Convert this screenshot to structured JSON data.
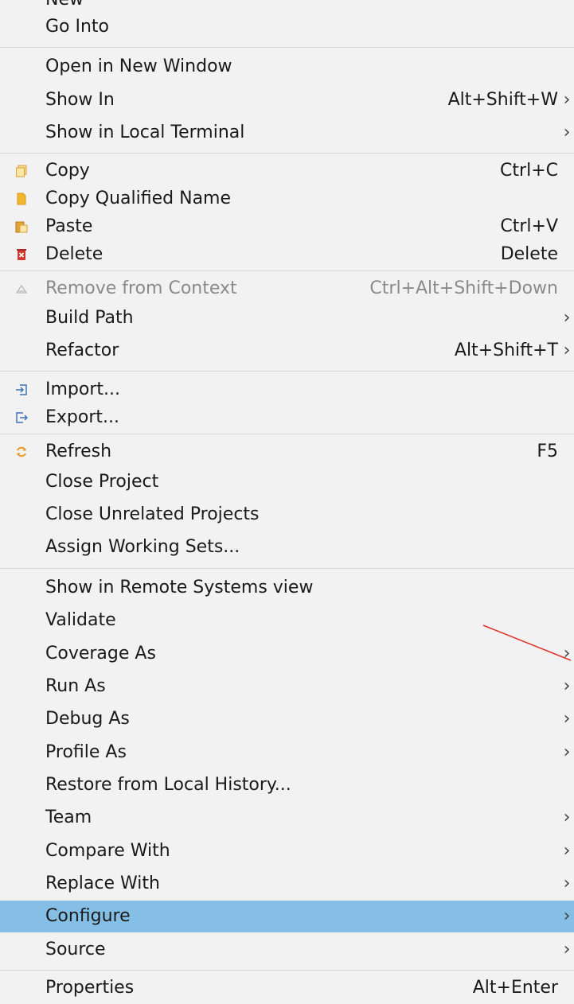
{
  "menu": {
    "partial_top": "New",
    "go_into": "Go Into",
    "open_new_window": "Open in New Window",
    "show_in": {
      "label": "Show In",
      "shortcut": "Alt+Shift+W"
    },
    "show_local_terminal": "Show in Local Terminal",
    "copy": {
      "label": "Copy",
      "shortcut": "Ctrl+C"
    },
    "copy_qualified": "Copy Qualified Name",
    "paste": {
      "label": "Paste",
      "shortcut": "Ctrl+V"
    },
    "delete": {
      "label": "Delete",
      "shortcut": "Delete"
    },
    "remove_context": {
      "label": "Remove from Context",
      "shortcut": "Ctrl+Alt+Shift+Down"
    },
    "build_path": "Build Path",
    "refactor": {
      "label": "Refactor",
      "shortcut": "Alt+Shift+T"
    },
    "import": "Import...",
    "export": "Export...",
    "refresh": {
      "label": "Refresh",
      "shortcut": "F5"
    },
    "close_project": "Close Project",
    "close_unrelated": "Close Unrelated Projects",
    "assign_sets": "Assign Working Sets...",
    "show_remote": "Show in Remote Systems view",
    "validate": "Validate",
    "coverage_as": "Coverage As",
    "run_as": "Run As",
    "debug_as": "Debug As",
    "profile_as": "Profile As",
    "restore_history": "Restore from Local History...",
    "team": "Team",
    "compare_with": "Compare With",
    "replace_with": "Replace With",
    "configure": "Configure",
    "source": "Source",
    "properties": {
      "label": "Properties",
      "shortcut": "Alt+Enter"
    },
    "submenu_arrow": "›"
  },
  "colors": {
    "menu_bg": "#f2f2f2",
    "highlight": "#86bfe6",
    "separator": "#d6d6d6",
    "disabled_text": "#8a8a8a",
    "annotation_line": "#d9342b"
  }
}
